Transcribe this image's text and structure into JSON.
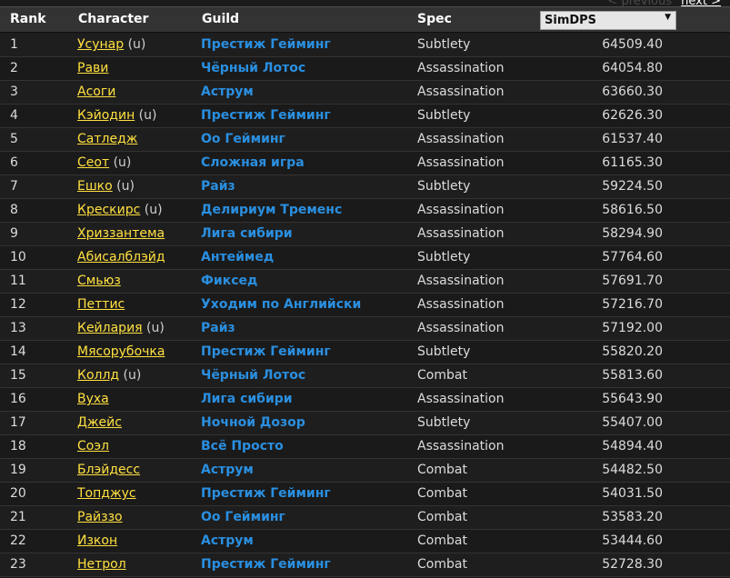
{
  "pager": {
    "previous": "< previous",
    "next": "next >"
  },
  "columns": {
    "rank": "Rank",
    "character": "Character",
    "guild": "Guild",
    "spec": "Spec",
    "sort": "SimDPS"
  },
  "rows": [
    {
      "rank": "1",
      "character": "Усунар",
      "suffix": "(u)",
      "guild": "Престиж Гейминг",
      "spec": "Subtlety",
      "dps": "64509.40"
    },
    {
      "rank": "2",
      "character": "Рави",
      "suffix": "",
      "guild": "Чёрный Лотос",
      "spec": "Assassination",
      "dps": "64054.80"
    },
    {
      "rank": "3",
      "character": "Асоги",
      "suffix": "",
      "guild": "Аструм",
      "spec": "Assassination",
      "dps": "63660.30"
    },
    {
      "rank": "4",
      "character": "Кэйодин",
      "suffix": "(u)",
      "guild": "Престиж Гейминг",
      "spec": "Subtlety",
      "dps": "62626.30"
    },
    {
      "rank": "5",
      "character": "Сатледж",
      "suffix": "",
      "guild": "Оо Гейминг",
      "spec": "Assassination",
      "dps": "61537.40"
    },
    {
      "rank": "6",
      "character": "Сеот",
      "suffix": "(u)",
      "guild": "Сложная игра",
      "spec": "Assassination",
      "dps": "61165.30"
    },
    {
      "rank": "7",
      "character": "Ешко",
      "suffix": "(u)",
      "guild": "Райз",
      "spec": "Subtlety",
      "dps": "59224.50"
    },
    {
      "rank": "8",
      "character": "Крескирс",
      "suffix": "(u)",
      "guild": "Делириум Тременс",
      "spec": "Assassination",
      "dps": "58616.50"
    },
    {
      "rank": "9",
      "character": "Хриззантема",
      "suffix": "",
      "guild": "Лига сибири",
      "spec": "Assassination",
      "dps": "58294.90"
    },
    {
      "rank": "10",
      "character": "Абисалблэйд",
      "suffix": "",
      "guild": "Антеймед",
      "spec": "Subtlety",
      "dps": "57764.60"
    },
    {
      "rank": "11",
      "character": "Смьюз",
      "suffix": "",
      "guild": "Фиксед",
      "spec": "Assassination",
      "dps": "57691.70"
    },
    {
      "rank": "12",
      "character": "Петтис",
      "suffix": "",
      "guild": "Уходим по Английски",
      "spec": "Assassination",
      "dps": "57216.70"
    },
    {
      "rank": "13",
      "character": "Кейлария",
      "suffix": "(u)",
      "guild": "Райз",
      "spec": "Assassination",
      "dps": "57192.00"
    },
    {
      "rank": "14",
      "character": "Мясорубочка",
      "suffix": "",
      "guild": "Престиж Гейминг",
      "spec": "Subtlety",
      "dps": "55820.20"
    },
    {
      "rank": "15",
      "character": "Коллд",
      "suffix": "(u)",
      "guild": "Чёрный Лотос",
      "spec": "Combat",
      "dps": "55813.60"
    },
    {
      "rank": "16",
      "character": "Вуха",
      "suffix": "",
      "guild": "Лига сибири",
      "spec": "Assassination",
      "dps": "55643.90"
    },
    {
      "rank": "17",
      "character": "Джейс",
      "suffix": "",
      "guild": "Ночной Дозор",
      "spec": "Subtlety",
      "dps": "55407.00"
    },
    {
      "rank": "18",
      "character": "Соэл",
      "suffix": "",
      "guild": "Всё Просто",
      "spec": "Assassination",
      "dps": "54894.40"
    },
    {
      "rank": "19",
      "character": "Блэйдесс",
      "suffix": "",
      "guild": "Аструм",
      "spec": "Combat",
      "dps": "54482.50"
    },
    {
      "rank": "20",
      "character": "Топджус",
      "suffix": "",
      "guild": "Престиж Гейминг",
      "spec": "Combat",
      "dps": "54031.50"
    },
    {
      "rank": "21",
      "character": "Райззо",
      "suffix": "",
      "guild": "Оо Гейминг",
      "spec": "Combat",
      "dps": "53583.20"
    },
    {
      "rank": "22",
      "character": "Изкон",
      "suffix": "",
      "guild": "Аструм",
      "spec": "Combat",
      "dps": "53444.60"
    },
    {
      "rank": "23",
      "character": "Нетрол",
      "suffix": "",
      "guild": "Престиж Гейминг",
      "spec": "Combat",
      "dps": "52728.30"
    }
  ]
}
